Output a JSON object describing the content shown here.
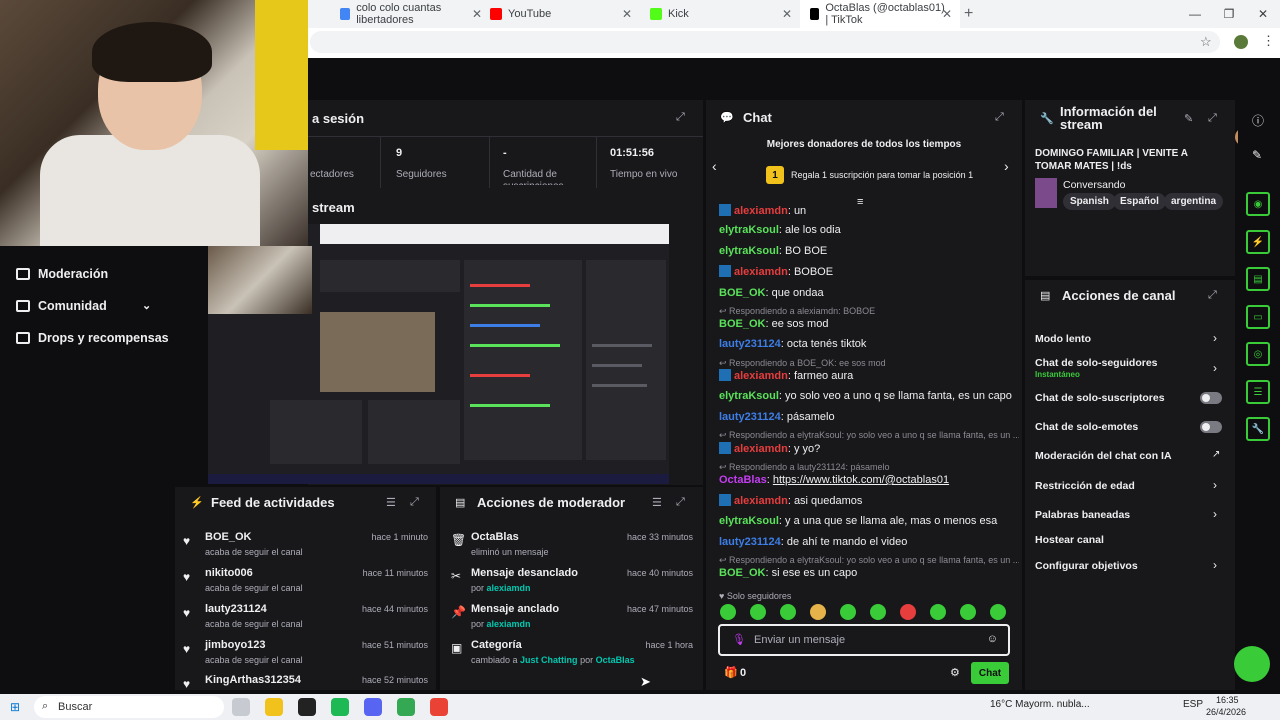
{
  "browser": {
    "tabs": [
      {
        "label": "colo colo cuantas libertadores",
        "color": "#4285f4"
      },
      {
        "label": "YouTube",
        "color": "#ff0000"
      },
      {
        "label": "Kick",
        "color": "#53fc18"
      },
      {
        "label": "OctaBlas (@octablas01) | TikTok",
        "color": "#010101"
      }
    ],
    "new_tab": "+",
    "star": "☆",
    "kebab": "⋮"
  },
  "sidebar": {
    "items": [
      {
        "label": "Moderación",
        "icon": "shield-icon"
      },
      {
        "label": "Comunidad",
        "icon": "people-icon"
      },
      {
        "label": "Drops y recompensas",
        "icon": "gift-icon"
      }
    ]
  },
  "session": {
    "title": "a sesión",
    "stats": [
      {
        "value": "",
        "label": "ectadores"
      },
      {
        "value": "9",
        "label": "Seguidores"
      },
      {
        "value": "-",
        "label": "Cantidad de suscripciones"
      },
      {
        "value": "01:51:56",
        "label": "Tiempo en vivo"
      }
    ]
  },
  "stream_preview": {
    "title": "stream"
  },
  "feed": {
    "title": "Feed de actividades",
    "items": [
      {
        "name": "BOE_OK",
        "sub": "acaba de seguir el canal",
        "time": "hace 1 minuto"
      },
      {
        "name": "nikito006",
        "sub": "acaba de seguir el canal",
        "time": "hace 11 minutos"
      },
      {
        "name": "lauty231124",
        "sub": "acaba de seguir el canal",
        "time": "hace 44 minutos"
      },
      {
        "name": "jimboyo123",
        "sub": "acaba de seguir el canal",
        "time": "hace 51 minutos"
      },
      {
        "name": "KingArthas312354",
        "sub": "",
        "time": "hace 52 minutos"
      }
    ]
  },
  "mod_actions": {
    "title": "Acciones de moderador",
    "items": [
      {
        "icon": "trash-icon",
        "name": "OctaBlas",
        "sub_pre": "eliminó un mensaje",
        "actor": "",
        "time": "hace 33 minutos"
      },
      {
        "icon": "unpin-icon",
        "name": "Mensaje desanclado",
        "sub_pre": "por",
        "actor": "alexiamdn",
        "time": "hace 40 minutos"
      },
      {
        "icon": "pin-icon",
        "name": "Mensaje anclado",
        "sub_pre": "por",
        "actor": "alexiamdn",
        "time": "hace 47 minutos"
      },
      {
        "icon": "category-icon",
        "name": "Categoría",
        "sub_pre": "cambiado a",
        "actor": "Just Chatting",
        "sub_mid": "por",
        "actor2": "OctaBlas",
        "time": "hace 1 hora"
      }
    ]
  },
  "chat": {
    "title": "Chat",
    "top_donors": "Mejores donadores de todos los tiempos",
    "donor_rank": "1",
    "donor_cta": "Regala 1 suscripción para tomar la posición 1",
    "messages": [
      {
        "type": "msg",
        "user": "alexiamdn",
        "color": "red",
        "badge": true,
        "text": "un"
      },
      {
        "type": "msg",
        "user": "elytraKsoul",
        "color": "green",
        "text": "ale los odia"
      },
      {
        "type": "msg",
        "user": "elytraKsoul",
        "color": "green",
        "text": "BO BOE"
      },
      {
        "type": "msg",
        "user": "alexiamdn",
        "color": "red",
        "badge": true,
        "text": "BOBOE"
      },
      {
        "type": "msg",
        "user": "BOE_OK",
        "color": "green",
        "text": "que ondaa"
      },
      {
        "type": "reply",
        "text": "Respondiendo a alexiamdn: BOBOE"
      },
      {
        "type": "msg",
        "user": "BOE_OK",
        "color": "green",
        "text": "ee sos mod"
      },
      {
        "type": "msg",
        "user": "lauty231124",
        "color": "blue",
        "text": "octa tenés tiktok"
      },
      {
        "type": "reply",
        "text": "Respondiendo a BOE_OK: ee sos mod"
      },
      {
        "type": "msg",
        "user": "alexiamdn",
        "color": "red",
        "badge": true,
        "text": "farmeo aura"
      },
      {
        "type": "msg",
        "user": "elytraKsoul",
        "color": "green",
        "text": "yo solo veo a uno q se llama fanta, es un capo"
      },
      {
        "type": "msg",
        "user": "lauty231124",
        "color": "blue",
        "text": "pásamelo"
      },
      {
        "type": "reply",
        "text": "Respondiendo a elytraKsoul: yo solo veo a uno q se llama fanta, es un ..."
      },
      {
        "type": "msg",
        "user": "alexiamdn",
        "color": "red",
        "badge": true,
        "text": "y yo?"
      },
      {
        "type": "reply",
        "text": "Respondiendo a lauty231124: pásamelo"
      },
      {
        "type": "msg",
        "user": "OctaBlas",
        "color": "purple",
        "text": "https://www.tiktok.com/@octablas01",
        "link": true
      },
      {
        "type": "msg",
        "user": "alexiamdn",
        "color": "red",
        "badge": true,
        "text": "asi quedamos"
      },
      {
        "type": "msg",
        "user": "elytraKsoul",
        "color": "green",
        "text": "y a una que se llama ale, mas o menos esa"
      },
      {
        "type": "msg",
        "user": "lauty231124",
        "color": "blue",
        "text": "de ahí te mando el video"
      },
      {
        "type": "reply",
        "text": "Respondiendo a elytraKsoul: yo solo veo a uno q se llama fanta, es un ..."
      },
      {
        "type": "msg",
        "user": "BOE_OK",
        "color": "green",
        "text": "si ese es un capo"
      }
    ],
    "followers_only": "Solo seguidores",
    "placeholder": "Enviar un mensaje",
    "points": "0",
    "send_label": "Chat"
  },
  "info": {
    "title": "Información del stream",
    "stream_title": "DOMINGO FAMILIAR | VENITE A TOMAR MATES | !ds",
    "category": "Conversando",
    "tags": [
      "Spanish",
      "Español",
      "argentina"
    ]
  },
  "channel_actions": {
    "title": "Acciones de canal",
    "items": [
      {
        "label": "Modo lento",
        "control": "chevron"
      },
      {
        "label": "Chat de solo-seguidores",
        "sub": "Instantáneo",
        "control": "chevron"
      },
      {
        "label": "Chat de solo-suscriptores",
        "control": "toggle"
      },
      {
        "label": "Chat de solo-emotes",
        "control": "toggle"
      },
      {
        "label": "Moderación del chat con IA",
        "control": "external"
      },
      {
        "label": "Restricción de edad",
        "control": "chevron"
      },
      {
        "label": "Palabras baneadas",
        "control": "chevron"
      },
      {
        "label": "Hostear canal",
        "control": "none"
      },
      {
        "label": "Configurar objetivos",
        "control": "chevron"
      }
    ]
  },
  "taskbar": {
    "search": "Buscar",
    "weather": "16°C  Mayorm. nubla...",
    "lang": "ESP",
    "time": "16:35",
    "date": "26/4/2026"
  }
}
